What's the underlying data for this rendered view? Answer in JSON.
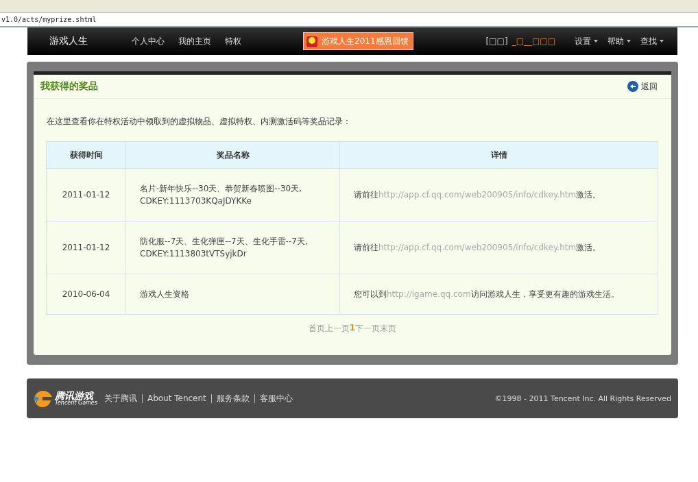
{
  "address_bar": {
    "url": "v1.0/acts/myprize.shtml"
  },
  "nav": {
    "logo": "游戏人生",
    "links": [
      "个人中心",
      "我的主页",
      "特权"
    ],
    "promo": "游戏人生2011感恩回馈",
    "user_tag": "[□□]",
    "username": "_□__□□□",
    "menus": [
      "设置",
      "帮助",
      "查找"
    ]
  },
  "panel": {
    "title": "我获得的奖品",
    "back": "返回",
    "intro": "在这里查看你在特权活动中领取到的虚拟物品、虚拟特权、内测激活码等奖品记录："
  },
  "table": {
    "columns": [
      "获得时间",
      "奖品名称",
      "详情"
    ],
    "rows": [
      {
        "time": "2011-01-12",
        "prize": [
          "名片-新年快乐--30天、恭贺新春喷图--30天,",
          "CDKEY:1113703KQaJDYKKe"
        ],
        "detail_before": "请前往",
        "detail_link": "http://app.cf.qq.com/web200905/info/cdkey.htm",
        "detail_after": "激活。"
      },
      {
        "time": "2011-01-12",
        "prize": [
          "防化服--7天、生化弹匣--7天、生化手雷--7天,",
          "CDKEY:1113803tVTSyjkDr"
        ],
        "detail_before": "请前往",
        "detail_link": "http://app.cf.qq.com/web200905/info/cdkey.htm",
        "detail_after": "激活。"
      },
      {
        "time": "2010-06-04",
        "prize": [
          "游戏人生资格"
        ],
        "detail_before": "您可以到",
        "detail_link": "http://igame.qq.com",
        "detail_after": "访问游戏人生，享受更有趣的游戏生活。"
      }
    ]
  },
  "pagination": [
    {
      "label": "首页",
      "selected": false
    },
    {
      "label": "上一页",
      "selected": false
    },
    {
      "label": "1",
      "selected": true
    },
    {
      "label": "下一页",
      "selected": false
    },
    {
      "label": "末页",
      "selected": false
    }
  ],
  "footer": {
    "logo_cn": "腾讯游戏",
    "logo_en": "Tencent Games",
    "links": [
      "关于腾讯",
      "About Tencent",
      "服务条款",
      "客服中心"
    ],
    "copyright": "©1998 - 2011 Tencent Inc. All Rights Reserved"
  }
}
